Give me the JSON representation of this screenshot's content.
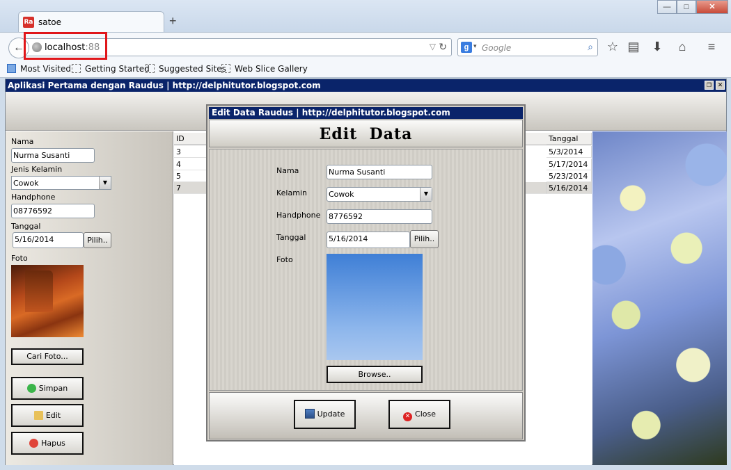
{
  "browser": {
    "tab_title": "satoe",
    "favicon_text": "Ra",
    "new_tab": "+",
    "url_host": "localhost",
    "url_port": ":88",
    "search_placeholder": "Google",
    "window_buttons": {
      "minimize": "—",
      "maximize": "□",
      "close": "✕"
    },
    "bookmarks": [
      "Most Visited",
      "Getting Started",
      "Suggested Sites",
      "Web Slice Gallery"
    ]
  },
  "app": {
    "title": "Aplikasi Pertama dengan Raudus | http://delphitutor.blogspot.com",
    "form": {
      "nama_label": "Nama",
      "nama_value": "Nurma Susanti",
      "jenis_label": "Jenis Kelamin",
      "jenis_value": "Cowok",
      "hp_label": "Handphone",
      "hp_value": "08776592",
      "tanggal_label": "Tanggal",
      "tanggal_value": "5/16/2014",
      "pilih_label": "Pilih..",
      "foto_label": "Foto",
      "cari_foto": "Cari Foto...",
      "simpan": "Simpan",
      "edit": "Edit",
      "hapus": "Hapus"
    },
    "grid": {
      "columns": [
        "ID",
        "Tanggal"
      ],
      "rows": [
        {
          "id": "3",
          "tanggal": "5/3/2014"
        },
        {
          "id": "4",
          "tanggal": "5/17/2014"
        },
        {
          "id": "5",
          "tanggal": "5/23/2014"
        },
        {
          "id": "7",
          "tanggal": "5/16/2014"
        }
      ]
    }
  },
  "dialog": {
    "title": "Edit Data Raudus | http://delphitutor.blogspot.com",
    "heading": "Edit  Data",
    "nama_label": "Nama",
    "nama_value": "Nurma Susanti",
    "kelamin_label": "Kelamin",
    "kelamin_value": "Cowok",
    "hp_label": "Handphone",
    "hp_value": "8776592",
    "tanggal_label": "Tanggal",
    "tanggal_value": "5/16/2014",
    "pilih_label": "Pilih..",
    "foto_label": "Foto",
    "browse": "Browse..",
    "update": "Update",
    "close": "Close"
  }
}
